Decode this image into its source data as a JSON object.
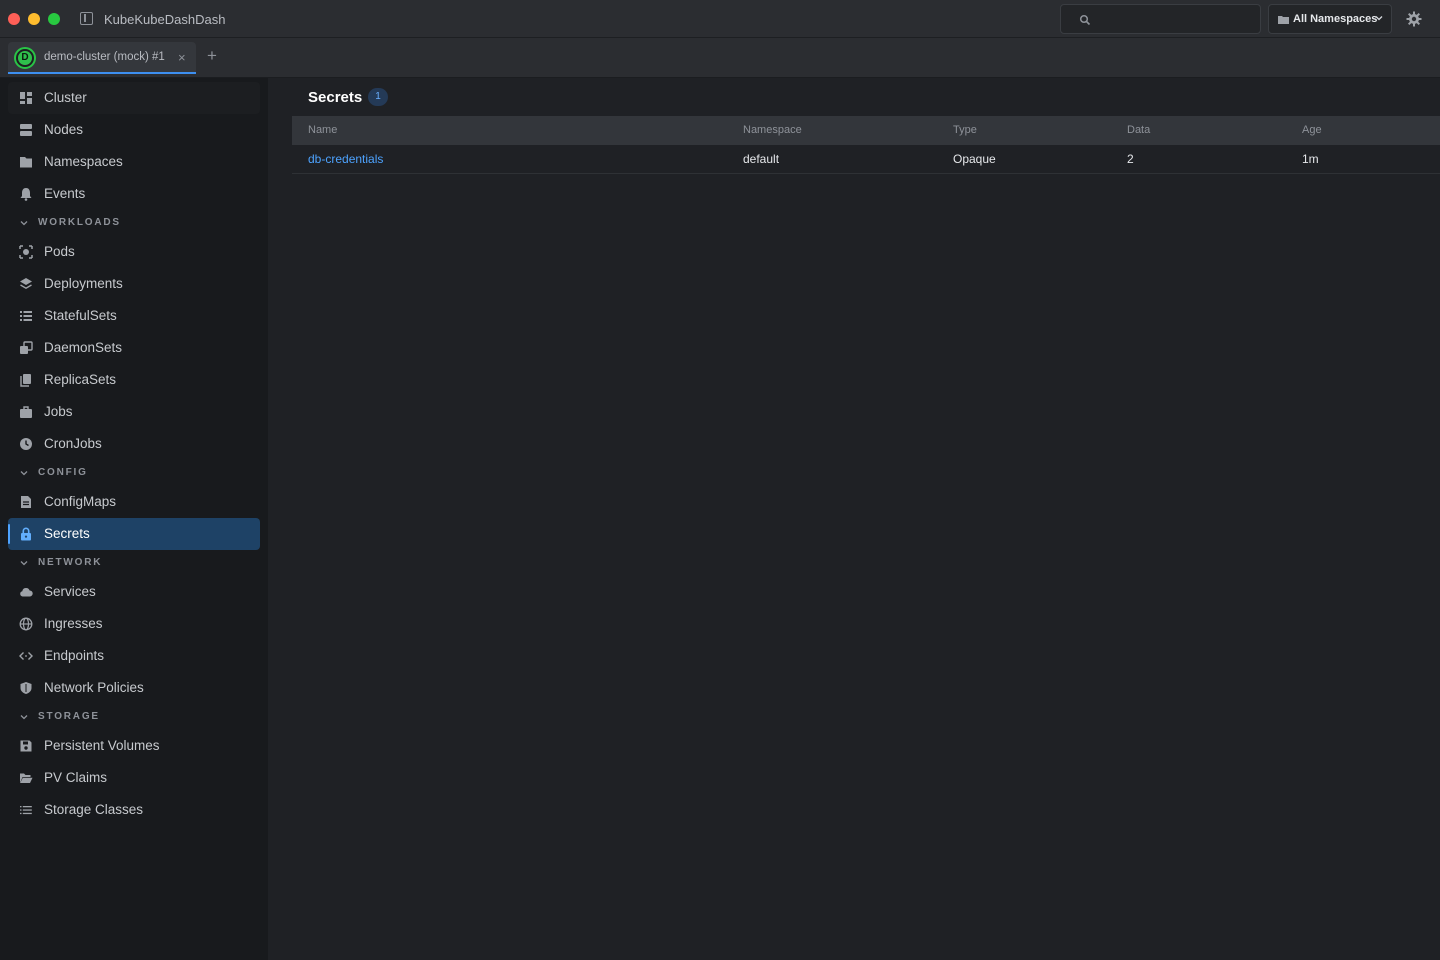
{
  "app": {
    "title": "KubeKubeDashDash"
  },
  "search": {
    "placeholder": ""
  },
  "namespace_select": {
    "value": "All Namespaces"
  },
  "tabs": [
    {
      "avatar": "D",
      "label": "demo-cluster (mock) #1",
      "close": "×"
    }
  ],
  "tab_add": "+",
  "sidebar": {
    "top_items": [
      {
        "label": "Cluster",
        "icon": "dashboard-icon"
      },
      {
        "label": "Nodes",
        "icon": "server-icon"
      },
      {
        "label": "Namespaces",
        "icon": "folder-icon"
      },
      {
        "label": "Events",
        "icon": "bell-icon"
      }
    ],
    "sections": [
      {
        "title": "WORKLOADS",
        "items": [
          {
            "label": "Pods",
            "icon": "pod-icon"
          },
          {
            "label": "Deployments",
            "icon": "layers-icon"
          },
          {
            "label": "StatefulSets",
            "icon": "list-icon"
          },
          {
            "label": "DaemonSets",
            "icon": "copy-icon"
          },
          {
            "label": "ReplicaSets",
            "icon": "stack-icon"
          },
          {
            "label": "Jobs",
            "icon": "briefcase-icon"
          },
          {
            "label": "CronJobs",
            "icon": "clock-icon"
          }
        ]
      },
      {
        "title": "CONFIG",
        "items": [
          {
            "label": "ConfigMaps",
            "icon": "document-icon"
          },
          {
            "label": "Secrets",
            "icon": "lock-icon",
            "active": true
          }
        ]
      },
      {
        "title": "NETWORK",
        "items": [
          {
            "label": "Services",
            "icon": "cloud-icon"
          },
          {
            "label": "Ingresses",
            "icon": "globe-icon"
          },
          {
            "label": "Endpoints",
            "icon": "code-icon"
          },
          {
            "label": "Network Policies",
            "icon": "shield-icon"
          }
        ]
      },
      {
        "title": "STORAGE",
        "items": [
          {
            "label": "Persistent Volumes",
            "icon": "save-icon"
          },
          {
            "label": "PV Claims",
            "icon": "folder-open-icon"
          },
          {
            "label": "Storage Classes",
            "icon": "lines-icon"
          }
        ]
      }
    ]
  },
  "main": {
    "title": "Secrets",
    "count": "1",
    "columns": [
      "Name",
      "Namespace",
      "Type",
      "Data",
      "Age"
    ],
    "rows": [
      {
        "name": "db-credentials",
        "namespace": "default",
        "type": "Opaque",
        "data": "2",
        "age": "1m"
      }
    ]
  },
  "colors": {
    "accent": "#4da3ff",
    "active_bg": "#1e4266",
    "sidebar_bg": "#181a1d",
    "main_bg": "#1f2125"
  }
}
